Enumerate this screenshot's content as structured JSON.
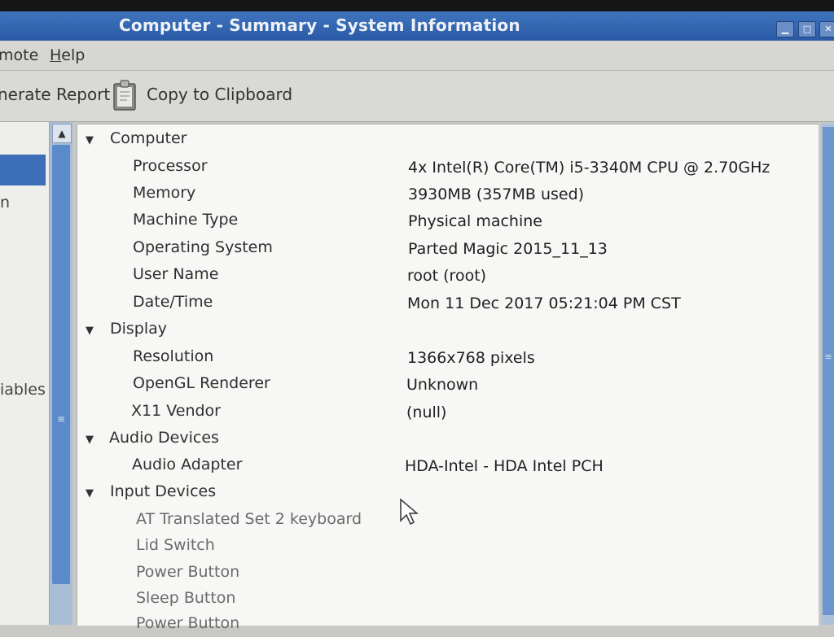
{
  "window": {
    "title": "Computer - Summary - System Information"
  },
  "menu": {
    "items": [
      {
        "label": "mote"
      },
      {
        "label": "Help",
        "mnemonic": "H",
        "rest": "elp"
      }
    ]
  },
  "toolbar": {
    "generate_report_label": "nerate Report",
    "copy_clipboard_label": "Copy to Clipboard"
  },
  "sidebar": {
    "fragments": [
      "n",
      "iables"
    ]
  },
  "summary": {
    "sections": [
      {
        "title": "Computer",
        "expanded": true,
        "rows": [
          {
            "label": "Processor",
            "value": "4x Intel(R) Core(TM) i5-3340M CPU @ 2.70GHz"
          },
          {
            "label": "Memory",
            "value": "3930MB (357MB used)"
          },
          {
            "label": "Machine Type",
            "value": "Physical machine"
          },
          {
            "label": "Operating System",
            "value": "Parted Magic 2015_11_13"
          },
          {
            "label": "User Name",
            "value": "root (root)"
          },
          {
            "label": "Date/Time",
            "value": "Mon 11 Dec 2017 05:21:04 PM CST"
          }
        ]
      },
      {
        "title": "Display",
        "expanded": true,
        "rows": [
          {
            "label": "Resolution",
            "value": "1366x768 pixels"
          },
          {
            "label": "OpenGL Renderer",
            "value": "Unknown"
          },
          {
            "label": "X11 Vendor",
            "value": "(null)"
          }
        ]
      },
      {
        "title": "Audio Devices",
        "expanded": true,
        "rows": [
          {
            "label": "Audio Adapter",
            "value": "HDA-Intel - HDA Intel PCH"
          }
        ]
      },
      {
        "title": "Input Devices",
        "expanded": true,
        "rows": [
          {
            "label": "AT Translated Set 2 keyboard",
            "value": ""
          },
          {
            "label": "Lid Switch",
            "value": ""
          },
          {
            "label": "Power Button",
            "value": ""
          },
          {
            "label": "Sleep Button",
            "value": ""
          },
          {
            "label": "Power Button",
            "value": ""
          }
        ]
      }
    ]
  },
  "icons": {
    "expander": "triangle-down-icon",
    "clipboard": "clipboard-icon",
    "cursor": "mouse-pointer-icon"
  },
  "colors": {
    "titlebar": "#2f63b0",
    "selection": "#3c6fb8",
    "panel_bg": "#f7f7f5"
  }
}
